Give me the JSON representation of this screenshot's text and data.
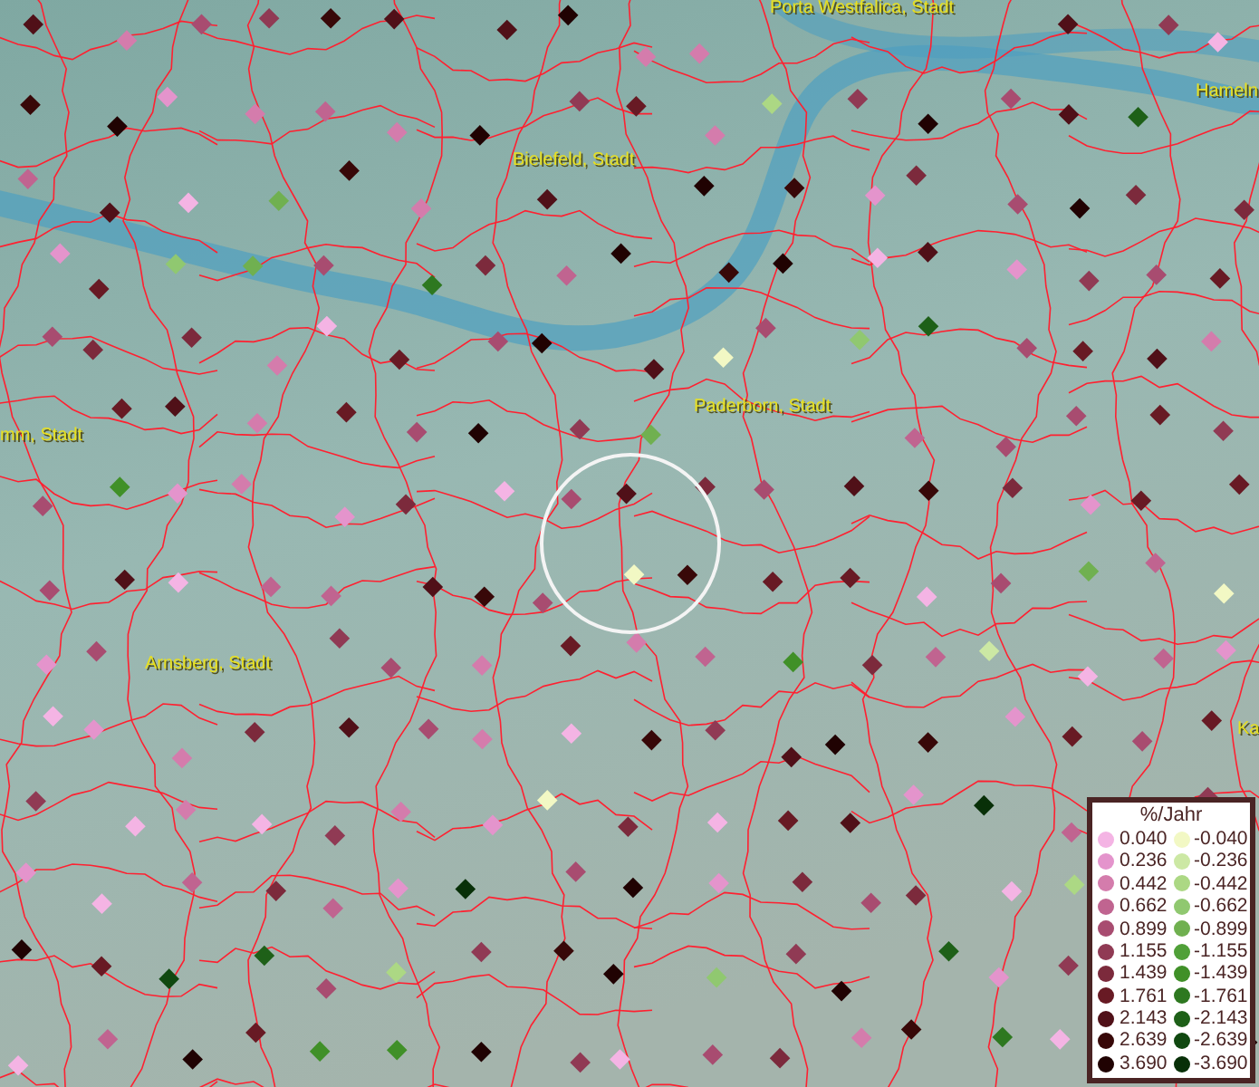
{
  "map": {
    "places": [
      {
        "name": "Porta Westfalica, Stadt"
      },
      {
        "name": "Hameln"
      },
      {
        "name": "Bielefeld, Stadt"
      },
      {
        "name": "Paderborn, Stadt"
      },
      {
        "name": "mm, Stadt"
      },
      {
        "name": "Arnsberg, Stadt"
      },
      {
        "name": "Ka"
      }
    ]
  },
  "legend": {
    "title": "%/Jahr",
    "increase": [
      {
        "value": "0.040",
        "color": "#f4b4e4"
      },
      {
        "value": "0.236",
        "color": "#e494cc"
      },
      {
        "value": "0.442",
        "color": "#d47cac"
      },
      {
        "value": "0.662",
        "color": "#c06490"
      },
      {
        "value": "0.899",
        "color": "#a84c70"
      },
      {
        "value": "1.155",
        "color": "#903a54"
      },
      {
        "value": "1.439",
        "color": "#7c2a3c"
      },
      {
        "value": "1.761",
        "color": "#681a24"
      },
      {
        "value": "2.143",
        "color": "#501018"
      },
      {
        "value": "2.639",
        "color": "#380808"
      },
      {
        "value": "3.690",
        "color": "#200202"
      }
    ],
    "decrease": [
      {
        "value": "-0.040",
        "color": "#f2f8c4"
      },
      {
        "value": "-0.236",
        "color": "#cce8a4"
      },
      {
        "value": "-0.442",
        "color": "#acd884"
      },
      {
        "value": "-0.662",
        "color": "#90c870"
      },
      {
        "value": "-0.899",
        "color": "#70b050"
      },
      {
        "value": "-1.155",
        "color": "#50a038"
      },
      {
        "value": "-1.439",
        "color": "#409028"
      },
      {
        "value": "-1.761",
        "color": "#2e7820"
      },
      {
        "value": "-2.143",
        "color": "#1e6018"
      },
      {
        "value": "-2.639",
        "color": "#104810"
      },
      {
        "value": "-3.690",
        "color": "#083008"
      }
    ]
  }
}
